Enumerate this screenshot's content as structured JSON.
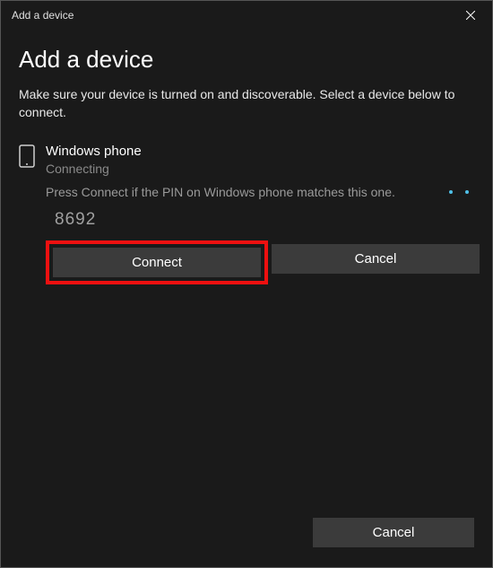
{
  "titlebar": {
    "title": "Add a device"
  },
  "header": {
    "title": "Add a device",
    "subtitle": "Make sure your device is turned on and discoverable. Select a device below to connect."
  },
  "device": {
    "name": "Windows phone",
    "status": "Connecting",
    "pin_instruction": "Press Connect if the PIN on Windows phone matches this one.",
    "pin": "8692"
  },
  "buttons": {
    "connect": "Connect",
    "cancel_inline": "Cancel",
    "cancel_footer": "Cancel"
  }
}
